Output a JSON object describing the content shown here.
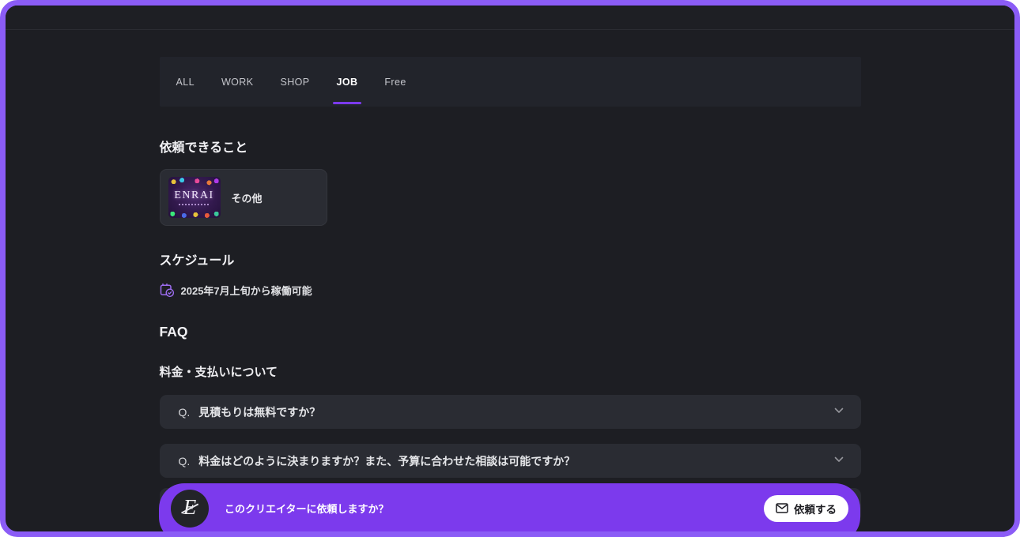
{
  "colors": {
    "accent": "#7c3aed",
    "frame_border": "#8b5cf6",
    "page_bg": "#1d1e23"
  },
  "tabs": {
    "items": [
      {
        "label": "ALL",
        "active": false
      },
      {
        "label": "WORK",
        "active": false
      },
      {
        "label": "SHOP",
        "active": false
      },
      {
        "label": "JOB",
        "active": true
      },
      {
        "label": "Free",
        "active": false
      }
    ]
  },
  "services": {
    "title": "依頼できること",
    "card": {
      "label": "その他",
      "thumbnail_title": "ENRAI"
    }
  },
  "schedule": {
    "title": "スケジュール",
    "availability": "2025年7月上旬から稼働可能"
  },
  "faq": {
    "title": "FAQ",
    "group_title": "料金・支払いについて",
    "items": [
      {
        "prefix": "Q.",
        "question": "見積もりは無料ですか？"
      },
      {
        "prefix": "Q.",
        "question": "料金はどのように決まりますか？また、予算に合わせた相談は可能ですか？"
      },
      {
        "prefix": "",
        "question": ""
      }
    ]
  },
  "bottom_bar": {
    "avatar_letter": "E",
    "message": "このクリエイターに依頼しますか？",
    "cta_label": "依頼する"
  }
}
